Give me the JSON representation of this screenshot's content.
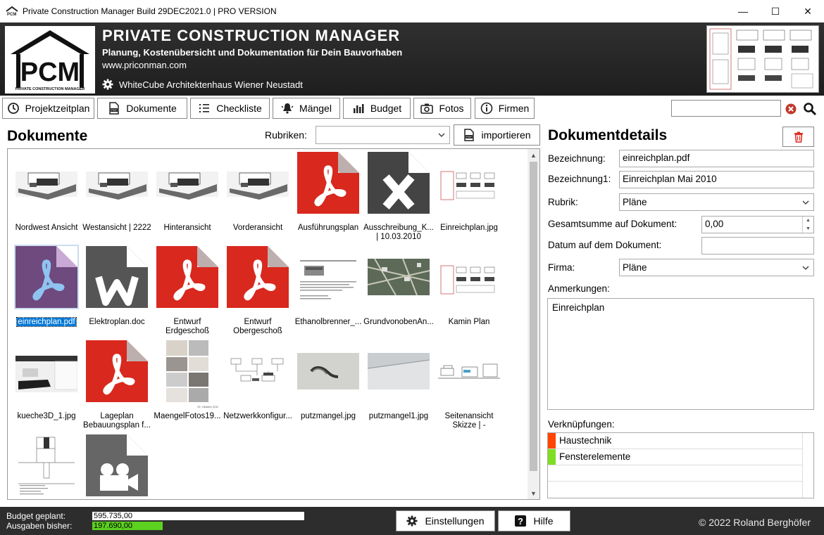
{
  "window": {
    "title": "Private Construction Manager Build 29DEC2021.0 | PRO VERSION"
  },
  "header": {
    "logo_text": "PCM",
    "logo_sub": "PRIVATE CONSTRUCTION MANAGER",
    "title": "PRIVATE CONSTRUCTION MANAGER",
    "subtitle": "Planung, Kostenübersicht und Dokumentation für Dein Bauvorhaben",
    "url": "www.priconman.com",
    "project": "WhiteCube Architektenhaus Wiener Neustadt"
  },
  "nav": [
    {
      "label": "Projektzeitplan",
      "icon": "clock-icon"
    },
    {
      "label": "Dokumente",
      "icon": "pdf-icon"
    },
    {
      "label": "Checkliste",
      "icon": "list-icon"
    },
    {
      "label": "Mängel",
      "icon": "bell-icon"
    },
    {
      "label": "Budget",
      "icon": "bar-chart-icon"
    },
    {
      "label": "Fotos",
      "icon": "camera-icon"
    },
    {
      "label": "Firmen",
      "icon": "info-icon"
    }
  ],
  "search": {
    "value": ""
  },
  "documents": {
    "title": "Dokumente",
    "rubriken_label": "Rubriken:",
    "rubriken_value": "",
    "import_label": "importieren",
    "items": [
      {
        "caption": "Nordwest Ansicht",
        "kind": "photo"
      },
      {
        "caption": "Westansicht | 2222",
        "kind": "photo"
      },
      {
        "caption": "Hinteransicht",
        "kind": "photo"
      },
      {
        "caption": "Vorderansicht",
        "kind": "photo"
      },
      {
        "caption": "Ausführungsplan",
        "kind": "pdf"
      },
      {
        "caption": "Ausschreibung_K... | 10.03.2010",
        "kind": "xls"
      },
      {
        "caption": "Einreichplan.jpg",
        "kind": "plan"
      },
      {
        "caption": "einreichplan.pdf",
        "kind": "pdf-selected"
      },
      {
        "caption": "Elektroplan.doc",
        "kind": "doc"
      },
      {
        "caption": "Entwurf Erdgeschoß",
        "kind": "pdf"
      },
      {
        "caption": "Entwurf Obergeschoß",
        "kind": "pdf"
      },
      {
        "caption": "Ethanolbrenner_...",
        "kind": "text"
      },
      {
        "caption": "GrundvonobenAn...",
        "kind": "aerial"
      },
      {
        "caption": "Kamin Plan",
        "kind": "plan"
      },
      {
        "caption": "kueche3D_1.jpg",
        "kind": "kitchen"
      },
      {
        "caption": "Lageplan Bebauungsplan f...",
        "kind": "pdf"
      },
      {
        "caption": "MaengelFotos19...",
        "kind": "collage"
      },
      {
        "caption": "Netzwerkkonfigur...",
        "kind": "diagram"
      },
      {
        "caption": "putzmangel.jpg",
        "kind": "wall"
      },
      {
        "caption": "putzmangel1.jpg",
        "kind": "wall2"
      },
      {
        "caption": "Seitenansicht Skizze | -",
        "kind": "sketch"
      },
      {
        "caption": "",
        "kind": "detail"
      },
      {
        "caption": "",
        "kind": "video"
      }
    ]
  },
  "details": {
    "title": "Dokumentdetails",
    "bezeichnung_label": "Bezeichnung:",
    "bezeichnung_value": "einreichplan.pdf",
    "bezeichnung1_label": "Bezeichnung1:",
    "bezeichnung1_value": "Einreichplan Mai 2010",
    "rubrik_label": "Rubrik:",
    "rubrik_value": "Pläne",
    "summe_label": "Gesamtsumme auf Dokument:",
    "summe_value": "0,00",
    "datum_label": "Datum auf dem Dokument:",
    "datum_value": "",
    "firma_label": "Firma:",
    "firma_value": "Pläne",
    "anmerkungen_label": "Anmerkungen:",
    "anmerkungen_value": "Einreichplan",
    "links_label": "Verknüpfungen:",
    "links": [
      {
        "label": "Haustechnik",
        "color": "#ff4500"
      },
      {
        "label": "Fensterelemente",
        "color": "#7fdd22"
      }
    ]
  },
  "footer": {
    "budget_label": "Budget  geplant:",
    "budget_value": "595.735,00",
    "spent_label": "Ausgaben bisher:",
    "spent_value": "197.690,00",
    "spent_fraction": 0.332,
    "settings_label": "Einstellungen",
    "help_label": "Hilfe",
    "copyright": "© 2022 Roland Berghöfer"
  },
  "colors": {
    "pdf_red": "#d9281e",
    "selected_purple": "#6f4a7e",
    "doc_gray": "#555555"
  }
}
